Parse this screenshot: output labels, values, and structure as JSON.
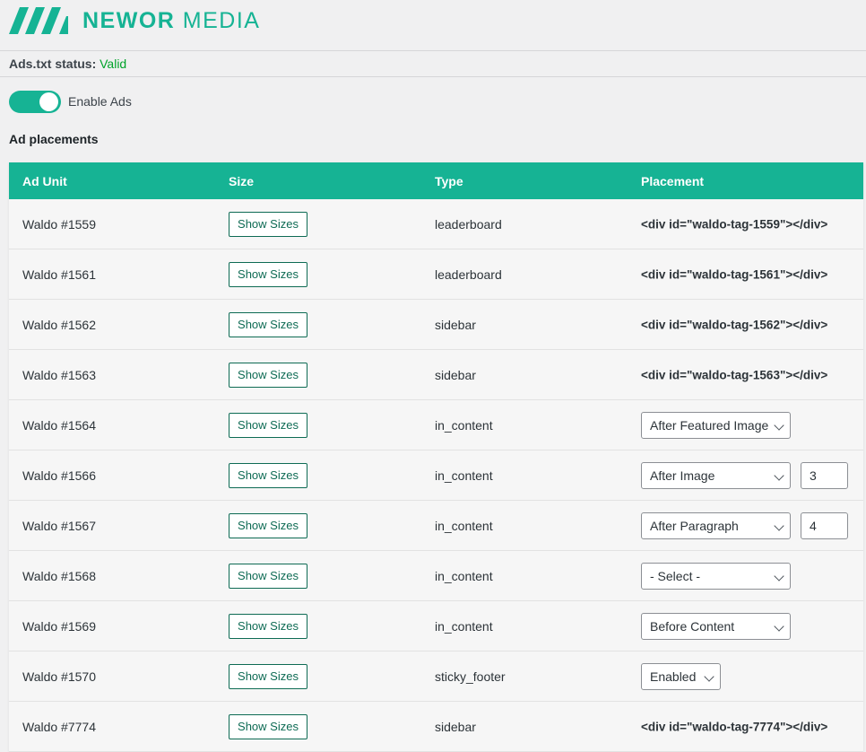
{
  "brand": {
    "name_bold": "NEWOR",
    "name_light": "MEDIA",
    "color": "#16b394"
  },
  "status": {
    "label": "Ads.txt status:",
    "value": "Valid",
    "value_color": "#00a32a"
  },
  "toggle": {
    "label": "Enable Ads",
    "enabled": true
  },
  "section_title": "Ad placements",
  "table": {
    "headers": [
      "Ad Unit",
      "Size",
      "Type",
      "Placement"
    ],
    "rows": [
      {
        "unit": "Waldo #1559",
        "button": "Show Sizes",
        "type": "leaderboard",
        "placement_kind": "code",
        "placement": "<div id=\"waldo-tag-1559\"></div>"
      },
      {
        "unit": "Waldo #1561",
        "button": "Show Sizes",
        "type": "leaderboard",
        "placement_kind": "code",
        "placement": "<div id=\"waldo-tag-1561\"></div>"
      },
      {
        "unit": "Waldo #1562",
        "button": "Show Sizes",
        "type": "sidebar",
        "placement_kind": "code",
        "placement": "<div id=\"waldo-tag-1562\"></div>"
      },
      {
        "unit": "Waldo #1563",
        "button": "Show Sizes",
        "type": "sidebar",
        "placement_kind": "code",
        "placement": "<div id=\"waldo-tag-1563\"></div>"
      },
      {
        "unit": "Waldo #1564",
        "button": "Show Sizes",
        "type": "in_content",
        "placement_kind": "select",
        "placement": "After Featured Image"
      },
      {
        "unit": "Waldo #1566",
        "button": "Show Sizes",
        "type": "in_content",
        "placement_kind": "select_num",
        "placement": "After Image",
        "number": "3"
      },
      {
        "unit": "Waldo #1567",
        "button": "Show Sizes",
        "type": "in_content",
        "placement_kind": "select_num",
        "placement": "After Paragraph",
        "number": "4"
      },
      {
        "unit": "Waldo #1568",
        "button": "Show Sizes",
        "type": "in_content",
        "placement_kind": "select",
        "placement": "- Select -"
      },
      {
        "unit": "Waldo #1569",
        "button": "Show Sizes",
        "type": "in_content",
        "placement_kind": "select",
        "placement": "Before Content"
      },
      {
        "unit": "Waldo #1570",
        "button": "Show Sizes",
        "type": "sticky_footer",
        "placement_kind": "select_small",
        "placement": "Enabled"
      },
      {
        "unit": "Waldo #7774",
        "button": "Show Sizes",
        "type": "sidebar",
        "placement_kind": "code",
        "placement": "<div id=\"waldo-tag-7774\"></div>"
      }
    ]
  }
}
